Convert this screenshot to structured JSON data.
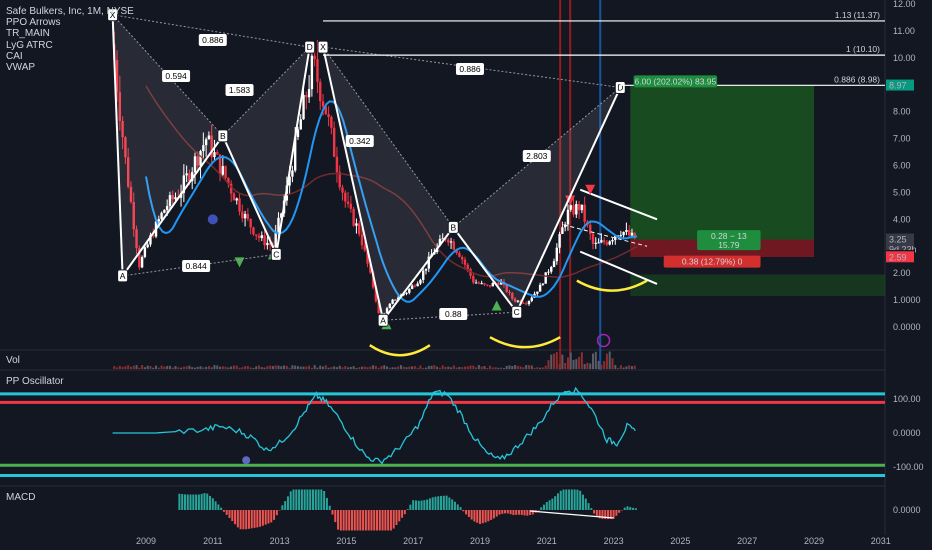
{
  "legend": {
    "title": "Safe Bulkers, Inc, 1M, NYSE",
    "indicators": [
      "PPO Arrows",
      "TR_MAIN",
      "LyG ATRC",
      "CAI",
      "VWAP"
    ]
  },
  "panes": {
    "vol_label": "Vol",
    "ppo_label": "PP Oscillator",
    "macd_label": "MACD"
  },
  "chart_data": [
    {
      "type": "candlestick",
      "title": "Safe Bulkers, Inc, 1M, NYSE",
      "x_axis": [
        "2009",
        "2011",
        "2013",
        "2015",
        "2017",
        "2019",
        "2021",
        "2023",
        "2025",
        "2027",
        "2029",
        "2031"
      ],
      "y_ticks": [
        "12.00",
        "11.00",
        "10.00",
        "9.00",
        "8.00",
        "7.00",
        "6.00",
        "5.00",
        "4.00",
        "3.00",
        "2.00",
        "1.0000",
        "0.0000"
      ],
      "ylim": [
        -0.5,
        12.3
      ],
      "price_path": [
        [
          2008.0,
          10.5
        ],
        [
          2008.4,
          6.0
        ],
        [
          2008.8,
          2.3
        ],
        [
          2009.2,
          3.5
        ],
        [
          2009.6,
          4.5
        ],
        [
          2010.0,
          5.0
        ],
        [
          2010.4,
          6.0
        ],
        [
          2010.8,
          7.0
        ],
        [
          2011.2,
          6.0
        ],
        [
          2011.6,
          5.0
        ],
        [
          2012.0,
          4.0
        ],
        [
          2012.4,
          3.3
        ],
        [
          2012.8,
          3.0
        ],
        [
          2013.2,
          5.0
        ],
        [
          2013.6,
          7.5
        ],
        [
          2014.0,
          9.8
        ],
        [
          2014.4,
          8.0
        ],
        [
          2014.8,
          5.5
        ],
        [
          2015.0,
          4.5
        ],
        [
          2015.4,
          3.5
        ],
        [
          2015.8,
          1.5
        ],
        [
          2016.0,
          0.3
        ],
        [
          2016.4,
          1.0
        ],
        [
          2016.8,
          1.3
        ],
        [
          2017.2,
          1.8
        ],
        [
          2017.6,
          2.8
        ],
        [
          2018.0,
          3.4
        ],
        [
          2018.4,
          2.7
        ],
        [
          2018.8,
          1.7
        ],
        [
          2019.2,
          1.5
        ],
        [
          2019.6,
          1.7
        ],
        [
          2020.0,
          1.0
        ],
        [
          2020.4,
          0.9
        ],
        [
          2020.8,
          1.5
        ],
        [
          2021.2,
          2.5
        ],
        [
          2021.6,
          4.2
        ],
        [
          2022.0,
          4.5
        ],
        [
          2022.4,
          3.0
        ],
        [
          2022.8,
          3.2
        ],
        [
          2023.2,
          3.6
        ],
        [
          2023.6,
          3.3
        ]
      ],
      "harmonic_points": [
        {
          "label": "X",
          "x": 2008.0,
          "y": 11.6
        },
        {
          "label": "A",
          "x": 2008.3,
          "y": 1.9
        },
        {
          "label": "B",
          "x": 2011.3,
          "y": 7.1
        },
        {
          "label": "C",
          "x": 2012.9,
          "y": 2.7
        },
        {
          "label": "D",
          "x": 2013.9,
          "y": 10.4
        },
        {
          "label": "X",
          "x": 2014.3,
          "y": 10.4
        },
        {
          "label": "A",
          "x": 2016.1,
          "y": 0.25
        },
        {
          "label": "B",
          "x": 2018.2,
          "y": 3.7
        },
        {
          "label": "C",
          "x": 2020.1,
          "y": 0.55
        },
        {
          "label": "D",
          "x": 2023.2,
          "y": 8.9
        }
      ],
      "ratio_labels": [
        "0.886",
        "0.594",
        "1.583",
        "0.844",
        "0.886",
        "0.342",
        "2.803",
        "0.88"
      ],
      "fib_levels": [
        {
          "label": "1.13 (11.37)",
          "y": 11.37
        },
        {
          "label": "1 (10.10)",
          "y": 10.1
        },
        {
          "label": "0.886 (8.98)",
          "y": 8.98
        }
      ],
      "target_box": "6.00 (202.02%) 83.95",
      "position_box": "0.28 − 13\n15.79",
      "stop_box": "0.38 (12.79%) 0",
      "price_tags": [
        {
          "text": "8.97",
          "color": "#089981"
        },
        {
          "text": "3.25",
          "color": "#363a45"
        },
        {
          "text": "9d 23h",
          "color": "#363a45"
        },
        {
          "text": "2.97",
          "color": "#131722"
        },
        {
          "text": "2.59",
          "color": "#f23645"
        }
      ],
      "colors": {
        "up": "#ffffff",
        "down": "#f23645",
        "ma_blue": "#2196f3",
        "pattern": "#ffffff",
        "yellow": "#ffeb3b",
        "target_green": "#1b5e20",
        "stop_red": "#801922"
      }
    },
    {
      "type": "line",
      "title": "PP Oscillator",
      "y_ticks": [
        "100.00",
        "0.0000",
        "-100.00"
      ],
      "ylim": [
        -170,
        170
      ],
      "series": [
        {
          "values_path": [
            [
              2008.0,
              0
            ],
            [
              2009.3,
              0
            ],
            [
              2010.0,
              5
            ],
            [
              2010.8,
              10
            ],
            [
              2011.2,
              20
            ],
            [
              2011.8,
              5
            ],
            [
              2012.2,
              -15
            ],
            [
              2012.6,
              -50
            ],
            [
              2013.0,
              -30
            ],
            [
              2013.4,
              10
            ],
            [
              2013.8,
              70
            ],
            [
              2014.1,
              110
            ],
            [
              2014.4,
              90
            ],
            [
              2014.8,
              40
            ],
            [
              2015.2,
              -20
            ],
            [
              2015.6,
              -70
            ],
            [
              2016.0,
              -85
            ],
            [
              2016.4,
              -60
            ],
            [
              2016.8,
              -20
            ],
            [
              2017.2,
              30
            ],
            [
              2017.6,
              120
            ],
            [
              2018.0,
              115
            ],
            [
              2018.4,
              60
            ],
            [
              2018.8,
              -10
            ],
            [
              2019.2,
              -60
            ],
            [
              2019.6,
              -80
            ],
            [
              2020.0,
              -50
            ],
            [
              2020.4,
              -10
            ],
            [
              2020.8,
              30
            ],
            [
              2021.2,
              90
            ],
            [
              2021.6,
              130
            ],
            [
              2022.0,
              120
            ],
            [
              2022.4,
              60
            ],
            [
              2022.8,
              -20
            ],
            [
              2023.1,
              -30
            ],
            [
              2023.4,
              20
            ],
            [
              2023.7,
              0
            ]
          ]
        }
      ],
      "bands": [
        {
          "y": 115,
          "color": "#26c6da"
        },
        {
          "y": 90,
          "color": "#f23645"
        },
        {
          "y": -95,
          "color": "#4caf50"
        },
        {
          "y": -125,
          "color": "#26c6da"
        }
      ]
    },
    {
      "type": "bar",
      "title": "MACD",
      "y_ticks": [
        "0.0000"
      ],
      "ylim": [
        -1.2,
        1.2
      ]
    }
  ]
}
